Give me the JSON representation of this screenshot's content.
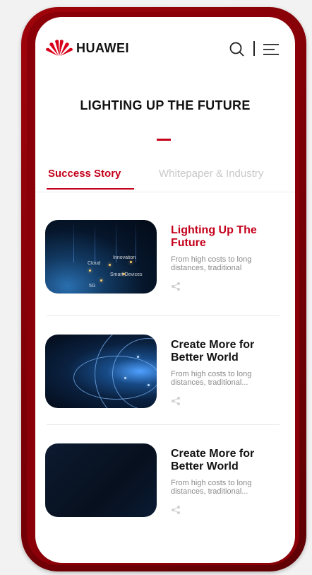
{
  "header": {
    "brand": "HUAWEI",
    "logo_icon": "huawei-flower-logo",
    "search_icon": "search-icon",
    "menu_icon": "menu-icon"
  },
  "hero": {
    "title": "LIGHTING UP THE FUTURE"
  },
  "tabs": [
    {
      "label": "Success Story",
      "active": true
    },
    {
      "label": "Whitepaper & Industry",
      "active": false
    }
  ],
  "cards": [
    {
      "title": "Lighting Up The Future",
      "desc": "From high costs to long distances, traditional",
      "image_labels": [
        "Cloud",
        "Smart Devices",
        "5G",
        "Innovation"
      ]
    },
    {
      "title": "Create More for Better World",
      "desc": "From high costs to long distances, traditional..."
    },
    {
      "title": "Create More for Better World",
      "desc": "From high costs to long distances, traditional..."
    }
  ],
  "colors": {
    "accent": "#c4001b",
    "frame": "#8b0008",
    "text": "#111111",
    "muted": "#8a8a8a"
  }
}
